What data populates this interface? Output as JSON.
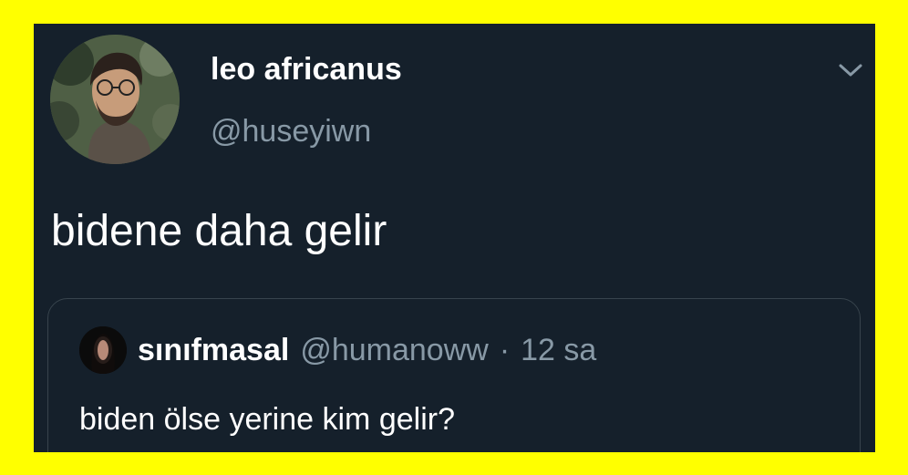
{
  "tweet": {
    "author": {
      "display_name": "leo africanus",
      "handle": "@huseyiwn",
      "avatar_icon": "profile-photo"
    },
    "text": "bidene daha gelir",
    "menu_icon": "chevron-down-icon",
    "quoted_tweet": {
      "author": {
        "display_name": "sınıfmasal",
        "handle": "@humanoww",
        "avatar_icon": "profile-photo"
      },
      "separator": "·",
      "time": "12 sa",
      "text": "biden ölse yerine kim gelir?"
    }
  },
  "colors": {
    "page_border": "#FFFF00",
    "background": "#15202B",
    "primary_text": "#FFFFFF",
    "secondary_text": "#8899A6",
    "quote_border": "#38444D"
  }
}
